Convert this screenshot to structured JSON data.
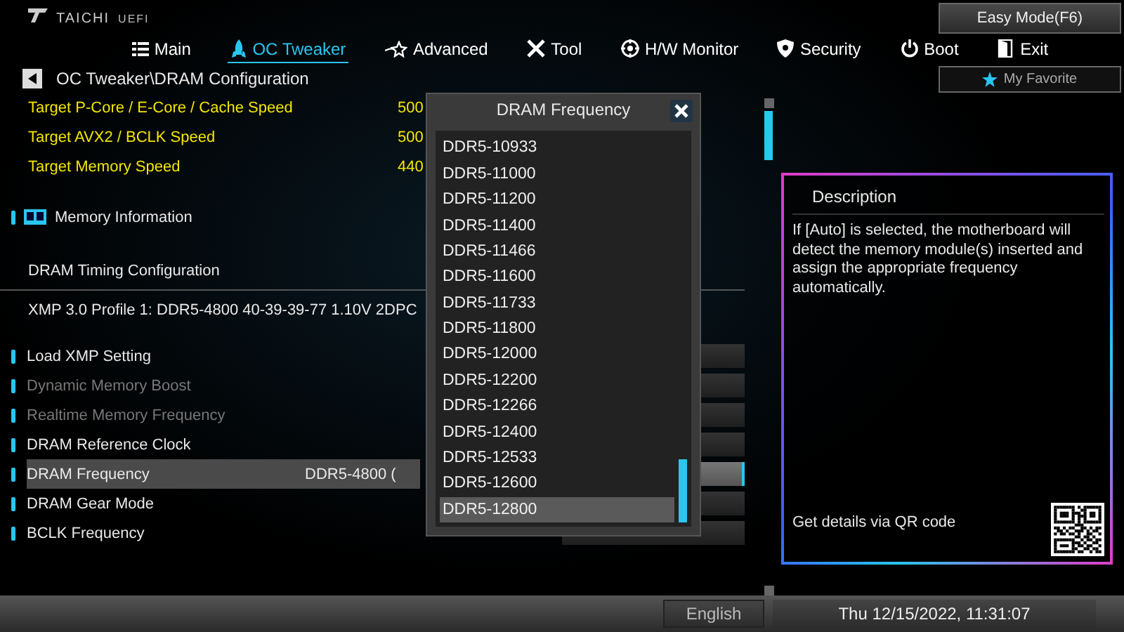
{
  "header": {
    "logo": "TAICHI",
    "logo_sub": "UEFI",
    "easy_mode": "Easy Mode(F6)"
  },
  "tabs": [
    {
      "label": "Main",
      "selected": false
    },
    {
      "label": "OC Tweaker",
      "selected": true
    },
    {
      "label": "Advanced",
      "selected": false
    },
    {
      "label": "Tool",
      "selected": false
    },
    {
      "label": "H/W Monitor",
      "selected": false
    },
    {
      "label": "Security",
      "selected": false
    },
    {
      "label": "Boot",
      "selected": false
    },
    {
      "label": "Exit",
      "selected": false
    }
  ],
  "breadcrumb": "OC Tweaker\\DRAM Configuration",
  "favorite": "My Favorite",
  "rows": [
    {
      "kind": "target",
      "label": "Target P-Core / E-Core / Cache Speed",
      "value": "500"
    },
    {
      "kind": "target",
      "label": "Target AVX2 / BCLK Speed",
      "value": "500"
    },
    {
      "kind": "target",
      "label": "Target Memory Speed",
      "value": "440"
    },
    {
      "kind": "section",
      "label": "Memory Information"
    },
    {
      "kind": "header",
      "label": "DRAM Timing Configuration"
    },
    {
      "kind": "info",
      "label": "XMP 3.0 Profile 1: DDR5-4800 40-39-39-77 1.10V 2DPC"
    },
    {
      "kind": "setting",
      "label": "Load XMP Setting",
      "disabled": false,
      "selected": false
    },
    {
      "kind": "setting",
      "label": "Dynamic Memory Boost",
      "disabled": true,
      "selected": false
    },
    {
      "kind": "setting",
      "label": "Realtime Memory Frequency",
      "disabled": true,
      "selected": false
    },
    {
      "kind": "setting",
      "label": "DRAM Reference Clock",
      "disabled": false,
      "selected": false
    },
    {
      "kind": "setting",
      "label": "DRAM Frequency",
      "disabled": false,
      "selected": true,
      "value": "DDR5-4800 ("
    },
    {
      "kind": "setting",
      "label": "DRAM Gear Mode",
      "disabled": false,
      "selected": false
    },
    {
      "kind": "setting",
      "label": "BCLK Frequency",
      "disabled": false,
      "selected": false
    }
  ],
  "dialog": {
    "title": "DRAM Frequency",
    "options": [
      {
        "label": "DDR5-10933",
        "selected": false
      },
      {
        "label": "DDR5-11000",
        "selected": false
      },
      {
        "label": "DDR5-11200",
        "selected": false
      },
      {
        "label": "DDR5-11400",
        "selected": false
      },
      {
        "label": "DDR5-11466",
        "selected": false
      },
      {
        "label": "DDR5-11600",
        "selected": false
      },
      {
        "label": "DDR5-11733",
        "selected": false
      },
      {
        "label": "DDR5-11800",
        "selected": false
      },
      {
        "label": "DDR5-12000",
        "selected": false
      },
      {
        "label": "DDR5-12200",
        "selected": false
      },
      {
        "label": "DDR5-12266",
        "selected": false
      },
      {
        "label": "DDR5-12400",
        "selected": false
      },
      {
        "label": "DDR5-12533",
        "selected": false
      },
      {
        "label": "DDR5-12600",
        "selected": false
      },
      {
        "label": "DDR5-12800",
        "selected": true
      }
    ]
  },
  "description": {
    "title": "Description",
    "text": "If [Auto] is selected, the motherboard will detect the memory module(s) inserted and assign the appropriate frequency automatically.",
    "qr_caption": "Get details via QR code"
  },
  "status_bar": {
    "language": "English",
    "datetime": "Thu 12/15/2022, 11:31:07"
  }
}
